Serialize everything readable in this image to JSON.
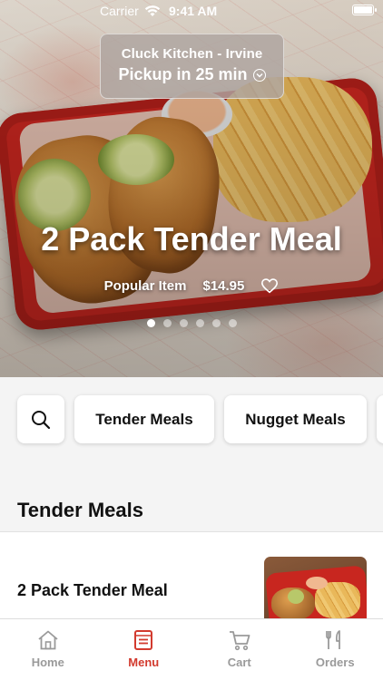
{
  "status_bar": {
    "carrier": "Carrier",
    "time": "9:41 AM"
  },
  "location": {
    "name": "Cluck Kitchen - Irvine",
    "pickup": "Pickup in 25 min"
  },
  "hero": {
    "title": "2 Pack Tender Meal",
    "tag": "Popular Item",
    "price": "$14.95",
    "carousel_count": 6,
    "carousel_active_index": 0
  },
  "categories": {
    "search_icon": "search-icon",
    "items": [
      "Tender Meals",
      "Nugget Meals"
    ]
  },
  "section": {
    "title": "Tender Meals"
  },
  "menu_items": [
    {
      "name": "2 Pack Tender Meal"
    }
  ],
  "tabbar": {
    "tabs": [
      {
        "label": "Home",
        "icon": "home-icon"
      },
      {
        "label": "Menu",
        "icon": "menu-icon"
      },
      {
        "label": "Cart",
        "icon": "cart-icon"
      },
      {
        "label": "Orders",
        "icon": "orders-icon"
      }
    ],
    "active_index": 1
  },
  "colors": {
    "accent": "#d23a2e",
    "inactive": "#9a9a9a"
  }
}
